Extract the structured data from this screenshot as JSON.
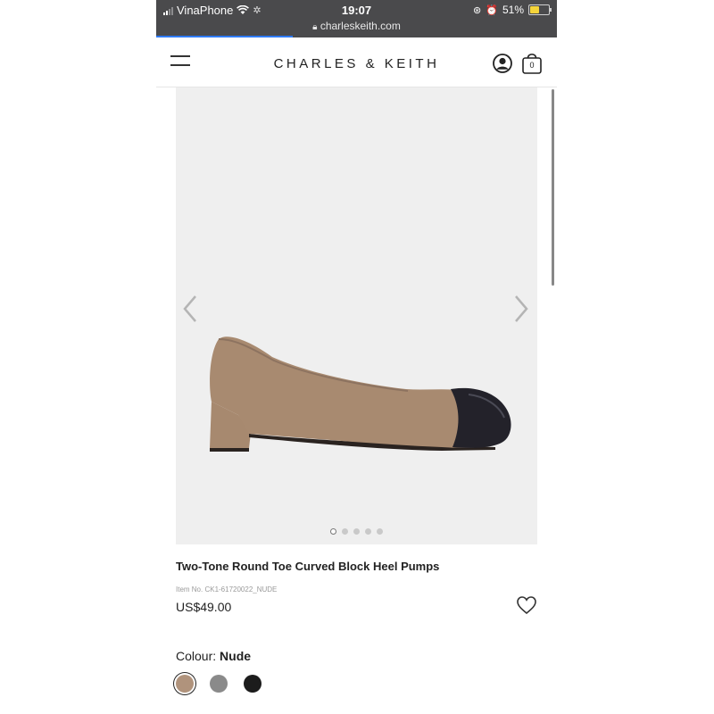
{
  "status_bar": {
    "carrier": "VinaPhone",
    "time": "19:07",
    "battery": "51%",
    "battery_level": 0.51,
    "url": "charleskeith.com",
    "load_progress": 0.34
  },
  "header": {
    "brand": "CHARLES & KEITH",
    "bag_count": "0",
    "icons": [
      "menu-icon",
      "user-icon",
      "bag-icon"
    ]
  },
  "gallery": {
    "image_count": 5,
    "active_index": 0,
    "icons": [
      "chevron-left-icon",
      "chevron-right-icon"
    ]
  },
  "product": {
    "title": "Two-Tone Round Toe Curved Block Heel Pumps",
    "item_no": "Item No. CK1-61720022_NUDE",
    "price": "US$49.00",
    "colour_label": "Colour:",
    "colour_value": "Nude",
    "swatches": [
      {
        "name": "nude",
        "color": "#b0937c"
      },
      {
        "name": "grey",
        "color": "#8a8a8a"
      },
      {
        "name": "black",
        "color": "#1c1c1c"
      }
    ]
  }
}
